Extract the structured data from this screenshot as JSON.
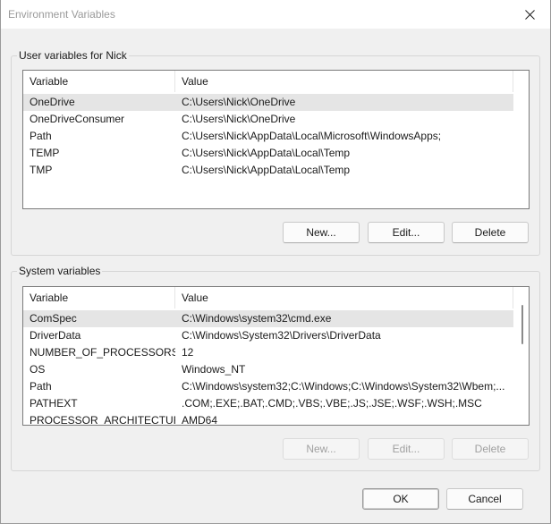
{
  "window": {
    "title": "Environment Variables",
    "close_icon": "close-icon"
  },
  "user_vars": {
    "group_label": "User variables for Nick",
    "columns": [
      "Variable",
      "Value"
    ],
    "rows": [
      {
        "variable": "OneDrive",
        "value": "C:\\Users\\Nick\\OneDrive"
      },
      {
        "variable": "OneDriveConsumer",
        "value": "C:\\Users\\Nick\\OneDrive"
      },
      {
        "variable": "Path",
        "value": "C:\\Users\\Nick\\AppData\\Local\\Microsoft\\WindowsApps;"
      },
      {
        "variable": "TEMP",
        "value": "C:\\Users\\Nick\\AppData\\Local\\Temp"
      },
      {
        "variable": "TMP",
        "value": "C:\\Users\\Nick\\AppData\\Local\\Temp"
      }
    ],
    "selected_row": 0,
    "buttons": {
      "new": "New...",
      "edit": "Edit...",
      "delete": "Delete"
    }
  },
  "system_vars": {
    "group_label": "System variables",
    "columns": [
      "Variable",
      "Value"
    ],
    "rows": [
      {
        "variable": "ComSpec",
        "value": "C:\\Windows\\system32\\cmd.exe"
      },
      {
        "variable": "DriverData",
        "value": "C:\\Windows\\System32\\Drivers\\DriverData"
      },
      {
        "variable": "NUMBER_OF_PROCESSORS",
        "value": "12"
      },
      {
        "variable": "OS",
        "value": "Windows_NT"
      },
      {
        "variable": "Path",
        "value": "C:\\Windows\\system32;C:\\Windows;C:\\Windows\\System32\\Wbem;..."
      },
      {
        "variable": "PATHEXT",
        "value": ".COM;.EXE;.BAT;.CMD;.VBS;.VBE;.JS;.JSE;.WSF;.WSH;.MSC"
      },
      {
        "variable": "PROCESSOR_ARCHITECTURE",
        "value": "AMD64"
      }
    ],
    "selected_row": 0,
    "buttons": {
      "new": "New...",
      "edit": "Edit...",
      "delete": "Delete"
    }
  },
  "footer": {
    "ok": "OK",
    "cancel": "Cancel"
  },
  "colors": {
    "background": "#f0f0f0",
    "selection": "#e5e5e5",
    "disabled_text": "#a0a0a0"
  }
}
